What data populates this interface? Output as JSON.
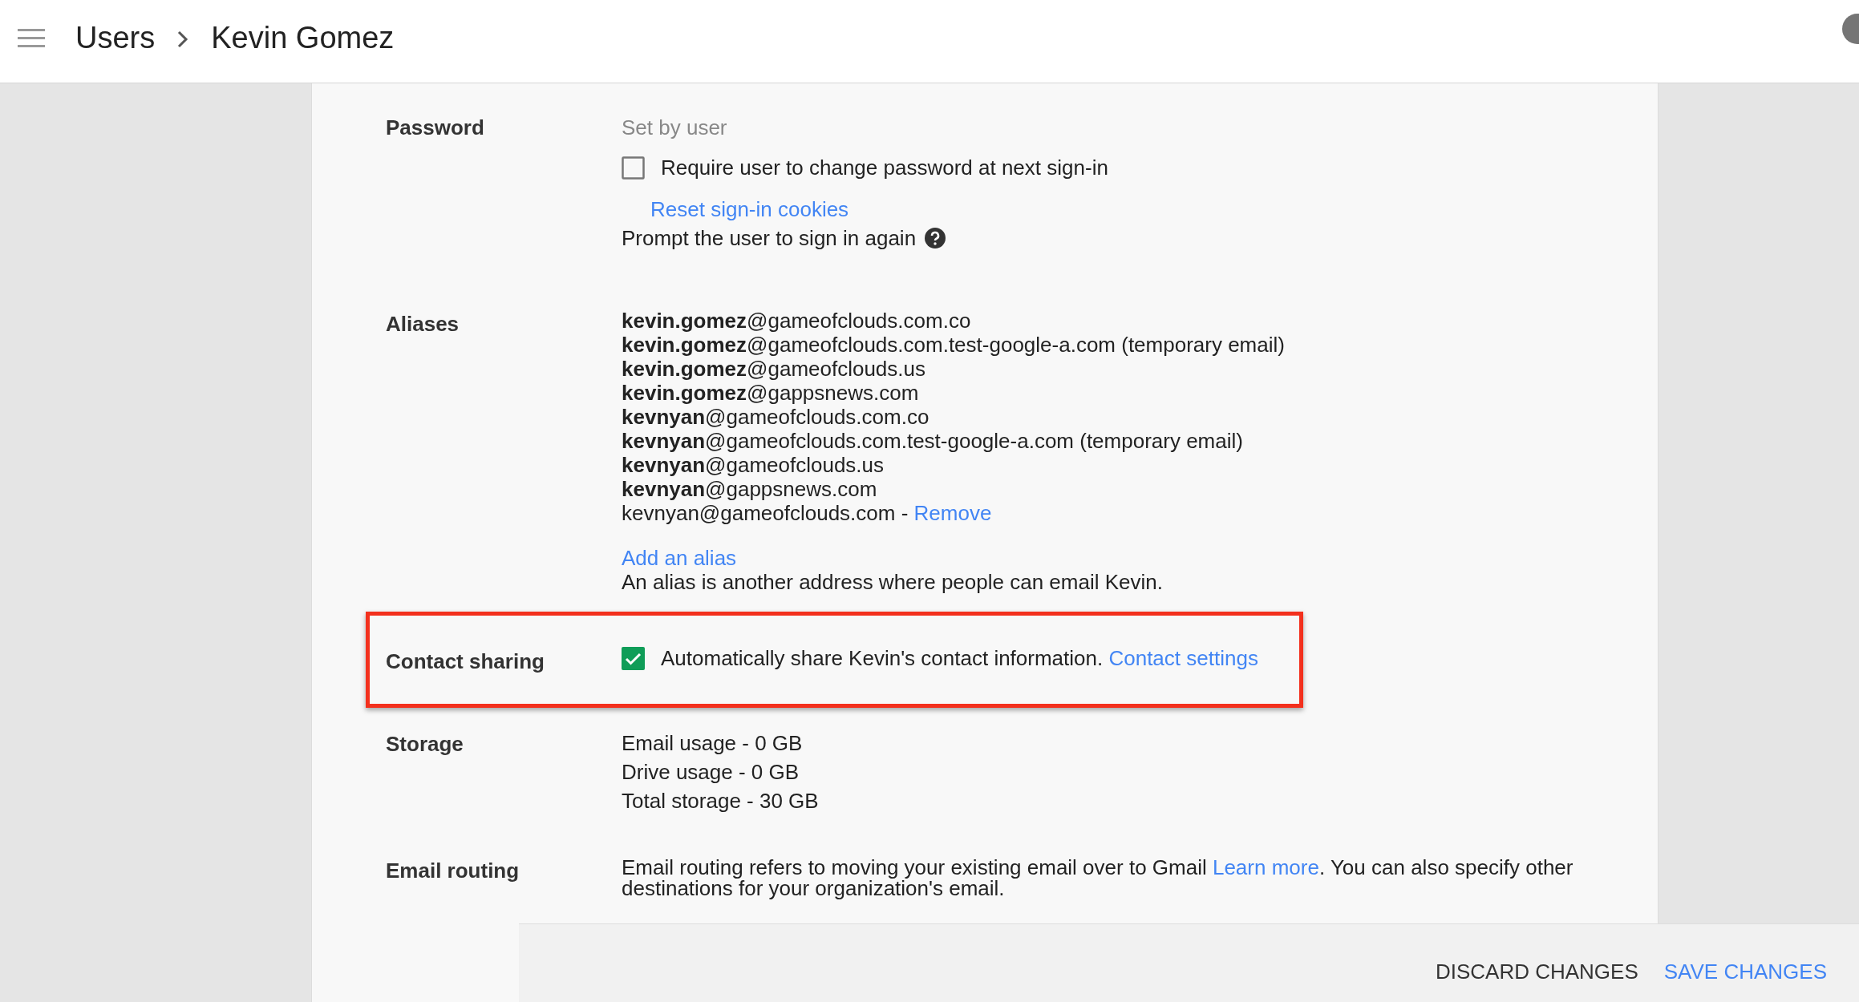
{
  "header": {
    "breadcrumb": [
      {
        "label": "Users"
      },
      {
        "label": "Kevin Gomez"
      }
    ]
  },
  "sections": [
    {
      "kind": "password",
      "label": "Password",
      "status": "Set by user",
      "checkbox": {
        "label": "Require user to change password at next sign-in",
        "checked": false
      },
      "link": "Reset sign-in cookies",
      "hint": "Prompt the user to sign in again"
    },
    {
      "kind": "aliases",
      "label": "Aliases",
      "aliases": [
        {
          "address": "**kevin.gomez**@gameofclouds.com.co"
        },
        {
          "address": "**kevin.gomez**@gameofclouds.com.test-google-a.com (temporary email)"
        },
        {
          "address": "**kevin.gomez**@gameofclouds.us"
        },
        {
          "address": "**kevin.gomez**@gappsnews.com"
        },
        {
          "address": "**kevnyan**@gameofclouds.com.co"
        },
        {
          "address": "**kevnyan**@gameofclouds.com.test-google-a.com (temporary email)"
        },
        {
          "address": "**kevnyan**@gameofclouds.us"
        },
        {
          "address": "**kevnyan**@gappsnews.com"
        },
        {
          "address": "kevnyan@gameofclouds.com - ",
          "remove_link": "Remove"
        }
      ],
      "link": "Add an alias",
      "hint": "An alias is another address where people can email Kevin."
    },
    {
      "kind": "contact",
      "label": "Contact sharing",
      "highlighted": true,
      "checkbox": {
        "label": "Automatically share Kevin's contact information.",
        "checked": true
      },
      "link": "Contact settings"
    },
    {
      "kind": "storage",
      "label": "Storage",
      "lines": [
        "Email usage - 0 GB",
        "Drive usage - 0 GB",
        "Total storage - 30 GB"
      ]
    },
    {
      "kind": "routing",
      "label": "Email routing",
      "text_before": "Email routing refers to moving your existing email over to Gmail ",
      "link": "Learn more",
      "text_after": ". You can also specify other destinations for your organization's email."
    }
  ],
  "actions": [
    {
      "label": "DISCARD CHANGES",
      "primary": false
    },
    {
      "label": "SAVE CHANGES",
      "primary": true
    }
  ]
}
